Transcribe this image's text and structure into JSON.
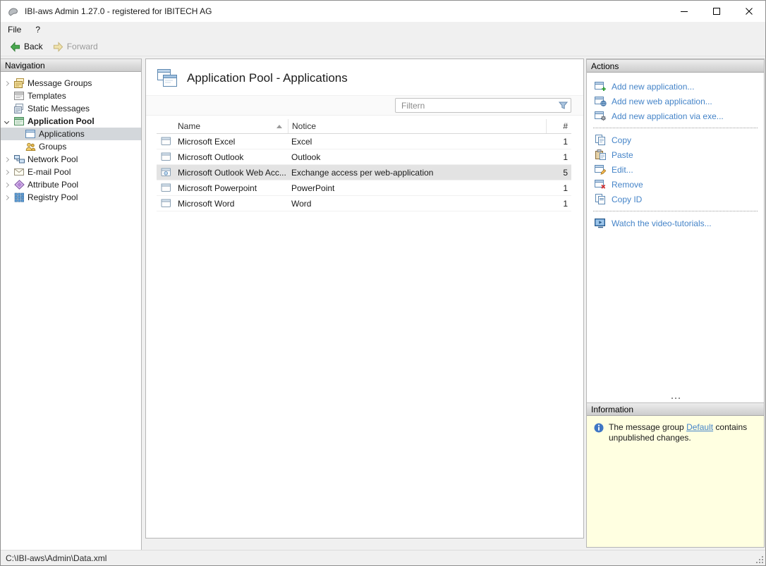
{
  "window": {
    "title": "IBI-aws Admin 1.27.0 - registered for IBITECH AG"
  },
  "menubar": {
    "items": [
      {
        "label": "File"
      },
      {
        "label": "?"
      }
    ]
  },
  "toolbar": {
    "back_label": "Back",
    "forward_label": "Forward"
  },
  "navigation": {
    "header": "Navigation",
    "items": [
      {
        "label": "Message Groups",
        "icon": "message-groups-icon",
        "state": "collapsed",
        "selected": false
      },
      {
        "label": "Templates",
        "icon": "templates-icon",
        "state": "leaf",
        "selected": false
      },
      {
        "label": "Static Messages",
        "icon": "static-messages-icon",
        "state": "leaf",
        "selected": false
      },
      {
        "label": "Application Pool",
        "icon": "application-pool-icon",
        "state": "expanded",
        "selected": false
      },
      {
        "label": "Applications",
        "icon": "applications-icon",
        "state": "leaf",
        "selected": true
      },
      {
        "label": "Groups",
        "icon": "groups-icon",
        "state": "leaf",
        "selected": false
      },
      {
        "label": "Network Pool",
        "icon": "network-pool-icon",
        "state": "collapsed",
        "selected": false
      },
      {
        "label": "E-mail Pool",
        "icon": "email-pool-icon",
        "state": "collapsed",
        "selected": false
      },
      {
        "label": "Attribute Pool",
        "icon": "attribute-pool-icon",
        "state": "collapsed",
        "selected": false
      },
      {
        "label": "Registry Pool",
        "icon": "registry-pool-icon",
        "state": "collapsed",
        "selected": false
      }
    ]
  },
  "main": {
    "title": "Application Pool - Applications",
    "filter": {
      "placeholder": "Filtern"
    },
    "table": {
      "columns": [
        {
          "label": "Name",
          "sort": "asc"
        },
        {
          "label": "Notice",
          "sort": "none"
        },
        {
          "label": "#",
          "sort": "none"
        }
      ],
      "rows": [
        {
          "name": "Microsoft Excel",
          "notice": "Excel",
          "count": "1",
          "selected": false
        },
        {
          "name": "Microsoft Outlook",
          "notice": "Outlook",
          "count": "1",
          "selected": false
        },
        {
          "name": "Microsoft Outlook Web Acc...",
          "notice": "Exchange access per web-application",
          "count": "5",
          "selected": true
        },
        {
          "name": "Microsoft Powerpoint",
          "notice": "PowerPoint",
          "count": "1",
          "selected": false
        },
        {
          "name": "Microsoft Word",
          "notice": "Word",
          "count": "1",
          "selected": false
        }
      ]
    }
  },
  "actions": {
    "header": "Actions",
    "items": [
      {
        "label": "Add new application...",
        "icon": "add-application-icon"
      },
      {
        "label": "Add new web application...",
        "icon": "add-web-application-icon"
      },
      {
        "label": "Add new application via exe...",
        "icon": "add-application-exe-icon"
      },
      {
        "label": "Copy",
        "icon": "copy-icon"
      },
      {
        "label": "Paste",
        "icon": "paste-icon"
      },
      {
        "label": "Edit...",
        "icon": "edit-icon"
      },
      {
        "label": "Remove",
        "icon": "remove-icon"
      },
      {
        "label": "Copy ID",
        "icon": "copy-id-icon"
      },
      {
        "label": "Watch the video-tutorials...",
        "icon": "video-icon"
      }
    ]
  },
  "information": {
    "header": "Information",
    "message": {
      "before": "The message group ",
      "link": "Default",
      "after": " contains unpublished changes."
    }
  },
  "statusbar": {
    "path": "C:\\IBI-aws\\Admin\\Data.xml"
  },
  "colors": {
    "link": "#4584c8",
    "tree_selection": "#d3d7db",
    "row_selection": "#e3e3e3",
    "info_background": "#ffffe1"
  }
}
